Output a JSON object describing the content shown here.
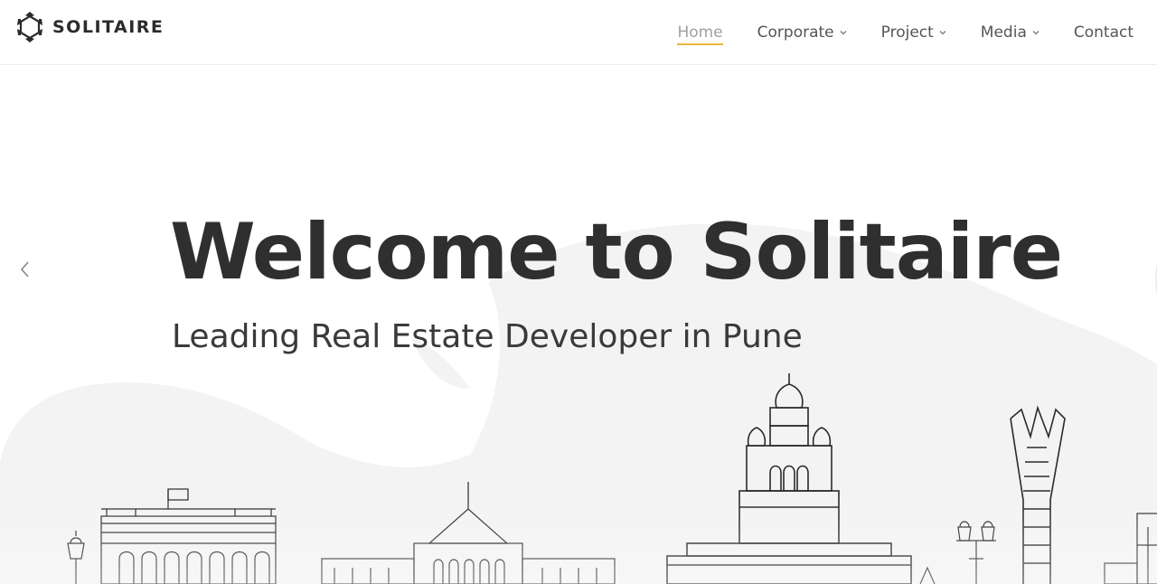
{
  "brand": {
    "name": "SOLITAIRE",
    "logo_icon": "hexagon-logo-icon"
  },
  "nav": {
    "items": [
      {
        "label": "Home",
        "active": true,
        "has_dropdown": false
      },
      {
        "label": "Corporate",
        "active": false,
        "has_dropdown": true
      },
      {
        "label": "Project",
        "active": false,
        "has_dropdown": true
      },
      {
        "label": "Media",
        "active": false,
        "has_dropdown": true
      },
      {
        "label": "Contact",
        "active": false,
        "has_dropdown": false
      }
    ],
    "active_underline_color": "#f0b43a"
  },
  "hero": {
    "title": "Welcome to Solitaire",
    "subtitle": "Leading Real Estate Developer in Pune",
    "prev_icon": "chevron-left-icon",
    "background_shape_color": "#f3f3f3",
    "skyline_line_color": "#2a2a2a"
  }
}
